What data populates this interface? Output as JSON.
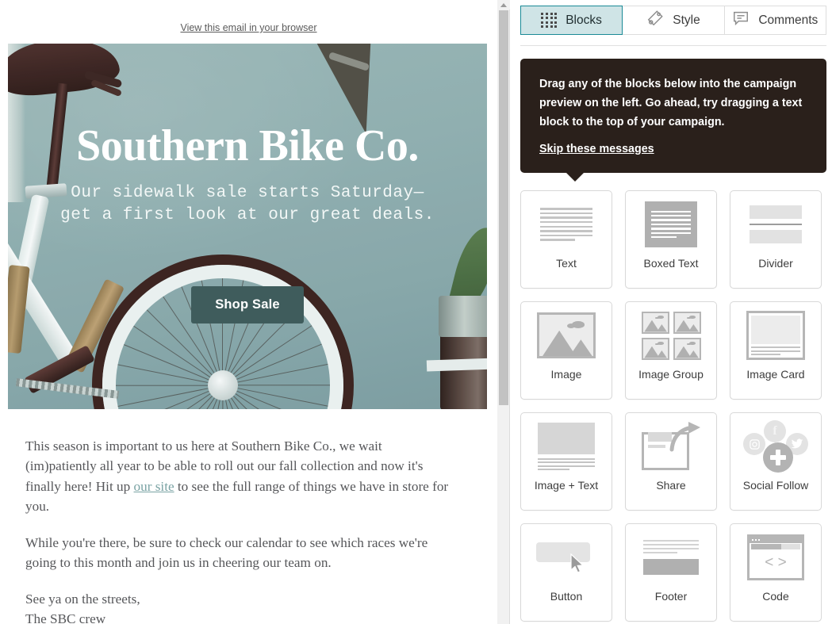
{
  "preview": {
    "view_browser_label": "View this email in your browser",
    "hero": {
      "title": "Southern Bike Co.",
      "subtitle_line1": "Our sidewalk sale starts Saturday—",
      "subtitle_line2": "get a first look at our great deals.",
      "cta_label": "Shop Sale",
      "cta_color": "#3f5c5c"
    },
    "body": {
      "paragraph1_before_link": "This season is important to us here at Southern Bike Co., we wait (im)patiently all year to be able to roll out our fall collection and now it's finally here! Hit up ",
      "paragraph1_link": "our site",
      "paragraph1_after_link": " to see the full range of things we have in store for you.",
      "paragraph2": "While you're there, be sure to check our calendar to see which races we're going to this month and join us in cheering our team on.",
      "paragraph3_line1": "See ya on the streets,",
      "paragraph3_line2": "The SBC crew",
      "link_color": "#7aa3a4"
    }
  },
  "panel": {
    "tabs": [
      {
        "label": "Blocks",
        "icon": "grid-dots-icon",
        "active": true
      },
      {
        "label": "Style",
        "icon": "paint-tag-icon",
        "active": false
      },
      {
        "label": "Comments",
        "icon": "comment-bubble-icon",
        "active": false
      }
    ],
    "tooltip": {
      "message": "Drag any of the blocks below into the campaign preview on the left. Go ahead, try dragging a text block to the top of your campaign.",
      "skip_label": "Skip these messages",
      "background": "#2a201b"
    },
    "blocks": [
      {
        "label": "Text",
        "icon": "text-lines-icon"
      },
      {
        "label": "Boxed Text",
        "icon": "boxed-text-icon"
      },
      {
        "label": "Divider",
        "icon": "divider-icon"
      },
      {
        "label": "Image",
        "icon": "image-icon"
      },
      {
        "label": "Image Group",
        "icon": "image-group-icon"
      },
      {
        "label": "Image Card",
        "icon": "image-card-icon"
      },
      {
        "label": "Image + Text",
        "icon": "image-text-icon"
      },
      {
        "label": "Share",
        "icon": "share-arrow-icon"
      },
      {
        "label": "Social Follow",
        "icon": "social-follow-icon"
      },
      {
        "label": "Button",
        "icon": "button-cursor-icon"
      },
      {
        "label": "Footer",
        "icon": "footer-icon"
      },
      {
        "label": "Code",
        "icon": "code-browser-icon"
      }
    ]
  },
  "colors": {
    "active_tab_bg": "#cfe4e6",
    "active_tab_border": "#1a8a96",
    "scrollbar_thumb": "#c2c2c2"
  }
}
